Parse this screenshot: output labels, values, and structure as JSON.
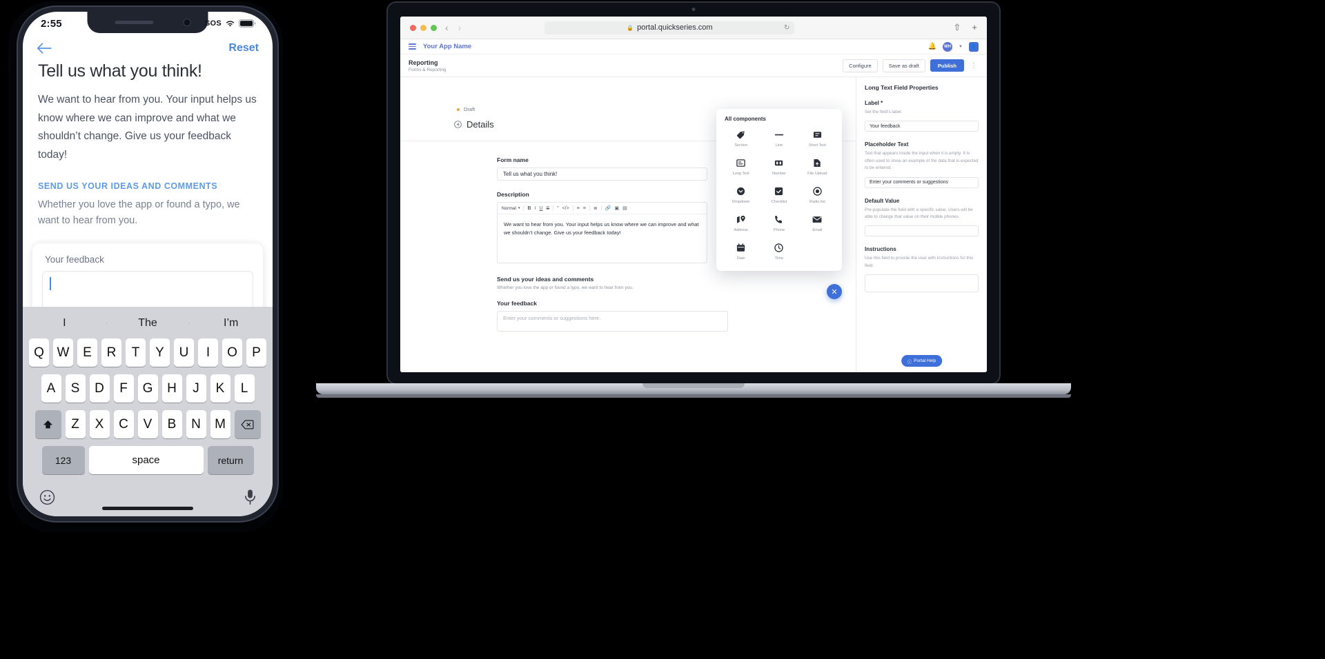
{
  "phone": {
    "status": {
      "time": "2:55",
      "sos": "SOS",
      "wifi_icon": "wifi-icon",
      "battery_icon": "battery-icon"
    },
    "nav": {
      "back_icon": "back-arrow-icon",
      "reset_label": "Reset"
    },
    "heading": "Tell us what you think!",
    "body": "We want to hear from you. Your input helps us know where we can improve and what we shouldn’t change. Give us your feedback today!",
    "section_title": "SEND US YOUR IDEAS AND COMMENTS",
    "section_body": "Whether you love the app or found a typo, we want to hear from you.",
    "field": {
      "label": "Your feedback",
      "value": ""
    },
    "accent_color": "#4a88e0",
    "keyboard": {
      "predictions": [
        "I",
        "The",
        "I’m"
      ],
      "row1": [
        "Q",
        "W",
        "E",
        "R",
        "T",
        "Y",
        "U",
        "I",
        "O",
        "P"
      ],
      "row2": [
        "A",
        "S",
        "D",
        "F",
        "G",
        "H",
        "J",
        "K",
        "L"
      ],
      "row3": [
        "Z",
        "X",
        "C",
        "V",
        "B",
        "N",
        "M"
      ],
      "shift_icon": "shift-icon",
      "backspace_icon": "backspace-icon",
      "numbers_label": "123",
      "space_label": "space",
      "return_label": "return",
      "emoji_icon": "emoji-icon",
      "mic_icon": "microphone-icon"
    }
  },
  "laptop": {
    "browser": {
      "url": "portal.quickseries.com",
      "lock_icon": "lock-icon",
      "back_icon": "chevron-left-icon",
      "forward_icon": "chevron-right-icon",
      "reload_icon": "reload-icon",
      "share_icon": "share-icon",
      "newtab_icon": "plus-icon",
      "traffic_colors": [
        "#ed6a5e",
        "#f5bd4f",
        "#61c454"
      ]
    },
    "app_header": {
      "menu_icon": "hamburger-menu-icon",
      "app_name": "Your App Name",
      "bell_icon": "bell-icon",
      "avatar_initials": "WH",
      "avatar_icon": "user-avatar-icon"
    },
    "toolbar": {
      "title": "Reporting",
      "subtitle": "Forms & Reporting",
      "configure_label": "Configure",
      "save_draft_label": "Save as draft",
      "publish_label": "Publish",
      "more_icon": "kebab-menu-icon"
    },
    "canvas": {
      "status_label": "Draft",
      "status_color": "#e8a33d",
      "details_label": "Details",
      "details_icon": "collapse-left-icon",
      "form_name_label": "Form name",
      "form_name_value": "Tell us what you think!",
      "description_label": "Description",
      "rte": {
        "style_select": "Normal",
        "icons": [
          "bold-icon",
          "italic-icon",
          "underline-icon",
          "strikethrough-icon",
          "quote-icon",
          "code-icon",
          "ordered-list-icon",
          "bullet-list-icon",
          "align-icon",
          "link-icon",
          "image-icon",
          "video-icon"
        ],
        "content": "We want to hear from you. Your input helps us know where we can improve and what we shouldn’t change. Give us your feedback today!"
      },
      "section_heading": "Send us your ideas and comments",
      "section_sub": "Whether you love the app or found a typo, we want to hear from you.",
      "field_label": "Your feedback",
      "field_placeholder": "Enter your comments or suggestions here."
    },
    "palette": {
      "title": "All components",
      "close_icon": "close-icon",
      "items": [
        {
          "label": "Section",
          "icon": "tag-icon"
        },
        {
          "label": "Line",
          "icon": "line-icon"
        },
        {
          "label": "Short Text",
          "icon": "short-text-icon"
        },
        {
          "label": "Long Text",
          "icon": "long-text-icon"
        },
        {
          "label": "Number",
          "icon": "number-icon"
        },
        {
          "label": "File Upload",
          "icon": "file-upload-icon"
        },
        {
          "label": "Dropdown",
          "icon": "dropdown-icon"
        },
        {
          "label": "Checklist",
          "icon": "checklist-icon"
        },
        {
          "label": "Radio list",
          "icon": "radio-icon"
        },
        {
          "label": "Address",
          "icon": "address-pin-icon"
        },
        {
          "label": "Phone",
          "icon": "phone-icon"
        },
        {
          "label": "Email",
          "icon": "email-icon"
        },
        {
          "label": "Date",
          "icon": "calendar-icon"
        },
        {
          "label": "Time",
          "icon": "clock-icon"
        }
      ]
    },
    "props": {
      "title": "Long Text Field Properties",
      "blocks": [
        {
          "heading": "Label *",
          "desc": "Set the field's label.",
          "value": "Your feedback"
        },
        {
          "heading": "Placeholder Text",
          "desc": "Text that appears inside the input when it is empty. It is often used to show an example of the data that is expected to be entered.",
          "value": "Enter your comments or suggestions"
        },
        {
          "heading": "Default Value",
          "desc": "Pre-populate the field with a specific value. Users will be able to change that value on their mobile phones.",
          "value": ""
        },
        {
          "heading": "Instructions",
          "desc": "Use this field to provide the user with instructions for this field.",
          "value": ""
        }
      ],
      "help_label": "Portal Help",
      "help_icon": "help-circle-icon",
      "accent_color": "#3f6fd8"
    }
  }
}
